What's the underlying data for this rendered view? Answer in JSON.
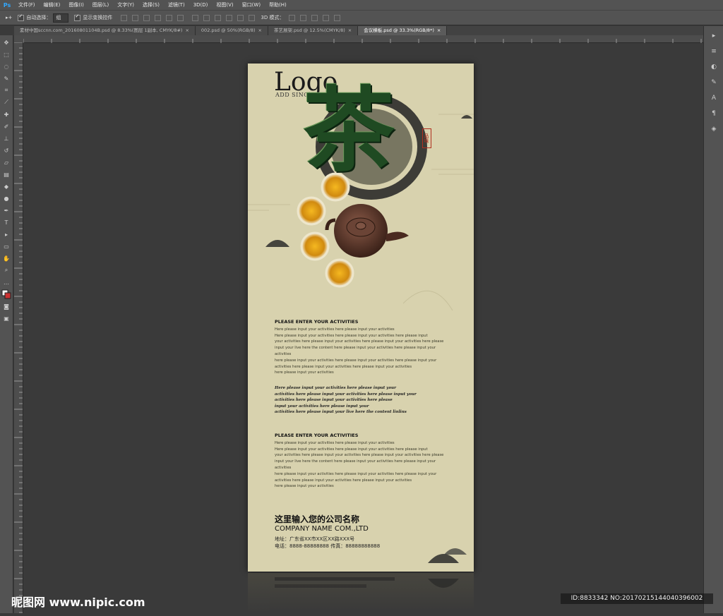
{
  "menu": {
    "app_icon": "Ps",
    "items": [
      "文件(F)",
      "编辑(E)",
      "图像(I)",
      "图层(L)",
      "文字(Y)",
      "选择(S)",
      "滤镜(T)",
      "3D(D)",
      "视图(V)",
      "窗口(W)",
      "帮助(H)"
    ]
  },
  "options": {
    "auto_select_label": "自动选择：",
    "auto_select_value": "组",
    "show_transform_label": "显示变换控件",
    "mode_3d_label": "3D 模式："
  },
  "tabs": [
    {
      "label": "素材中国sccnn.com_20160801104B.psd @ 8.33%(图层 1副本, CMYK/8#)",
      "close": "×"
    },
    {
      "label": "002.psd @ 50%(RGB/8)",
      "close": "×"
    },
    {
      "label": "茶艺展架.psd @ 12.5%(CMYK/8)",
      "close": "×"
    },
    {
      "label": "会议横板.psd @ 33.3%(RGB/8*)",
      "close": "×"
    }
  ],
  "poster": {
    "logo": "Logo",
    "logo_sub": "ADD SING",
    "big_char": "茶",
    "seal": "品味",
    "section1_title": "PLEASE ENTER YOUR ACTIVITIES",
    "section1_lines": [
      "Here please input your activities here please input your activities",
      "Here please input your activities here please input your activities here please input",
      "your activities here please input your activities here please input your activities here please",
      "input your live here the content here please input your activities here please input your activities",
      "here please input your activities here please input your activities here please input your",
      "activities here please input your activities here please input your activities",
      "here please input your activities"
    ],
    "script_lines": [
      "Here please input your activities here please input your",
      "activities here please input your activities here please input your",
      "activities here please input your activities here please",
      "input your activities here please input your",
      "activities here please input your live here the content linlins"
    ],
    "section2_title": "PLEASE ENTER YOUR ACTIVITIES",
    "section2_lines": [
      "Here please input your activities here please input your activities",
      "Here please input your activities here please input your activities here please input",
      "your activities here please input your activities here please input your activities here please",
      "input your live here the content here please input your activities here please input your activities",
      "here please input your activities here please input your activities here please input your",
      "activities here please input your activities here please input your activities",
      "here please input your activities"
    ],
    "company_cn": "这里输入您的公司名称",
    "company_en": "COMPANY NAME COM.,LTD",
    "address": "地址：广东省XX市XX区XX路XXX号",
    "phone": "电话：8888-88888888   传真：88888888888"
  },
  "watermark": {
    "left": "昵图网 www.nipic.com",
    "right": "ID:8833342 NO:20170215144040396002"
  },
  "colors": {
    "bg": "#3a3a3a",
    "panel": "#535353",
    "paper": "#d8d2ae",
    "tea_green": "#1f4a22",
    "seal_red": "#b03020"
  }
}
